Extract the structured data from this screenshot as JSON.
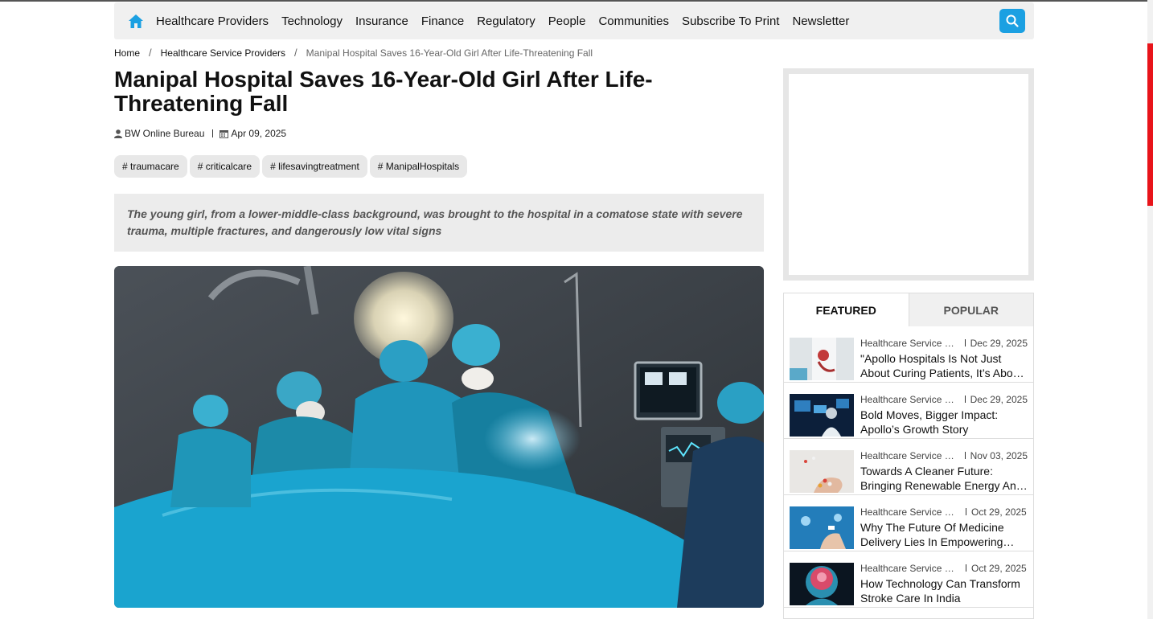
{
  "nav": {
    "items": [
      "Healthcare Providers",
      "Technology",
      "Insurance",
      "Finance",
      "Regulatory",
      "People",
      "Communities",
      "Subscribe To Print",
      "Newsletter"
    ]
  },
  "breadcrumb": {
    "home": "Home",
    "section": "Healthcare Service Providers",
    "current": "Manipal Hospital Saves 16-Year-Old Girl After Life-Threatening Fall",
    "separator": "/"
  },
  "article": {
    "title": "Manipal Hospital Saves 16-Year-Old Girl After Life-Threatening Fall",
    "author": "BW Online Bureau",
    "date": "Apr 09, 2025",
    "tags": [
      "# traumacare",
      "# criticalcare",
      "# lifesavingtreatment",
      "# ManipalHospitals"
    ],
    "summary": "The young girl, from a lower-middle-class background, was brought to the hospital in a comatose state with severe trauma, multiple fractures, and dangerously low vital signs"
  },
  "sidebar": {
    "tabs": [
      "FEATURED",
      "POPULAR"
    ],
    "items": [
      {
        "category": "Healthcare Service Providers",
        "date": "Dec 29, 2025",
        "headline": "\"Apollo Hospitals Is Not Just About Curing Patients, It’s About Caring\""
      },
      {
        "category": "Healthcare Service Providers",
        "date": "Dec 29, 2025",
        "headline": "Bold Moves, Bigger Impact: Apollo’s Growth Story"
      },
      {
        "category": "Healthcare Service Providers",
        "date": "Nov 03, 2025",
        "headline": " Towards A Cleaner Future: Bringing Renewable Energy And Sustainability"
      },
      {
        "category": "Healthcare Service Providers",
        "date": "Oct 29, 2025",
        "headline": "Why The Future Of Medicine Delivery Lies In Empowering Pharmacies"
      },
      {
        "category": "Healthcare Service Providers",
        "date": "Oct 29, 2025",
        "headline": "How Technology Can Transform Stroke Care In India"
      }
    ]
  },
  "colors": {
    "accent": "#1ba0e2",
    "scroll_thumb": "#e8141a",
    "nav_bg": "#f0f0f0"
  },
  "icons": {
    "home": "home-icon",
    "search": "search-icon",
    "author": "user-icon",
    "date": "calendar-icon"
  }
}
